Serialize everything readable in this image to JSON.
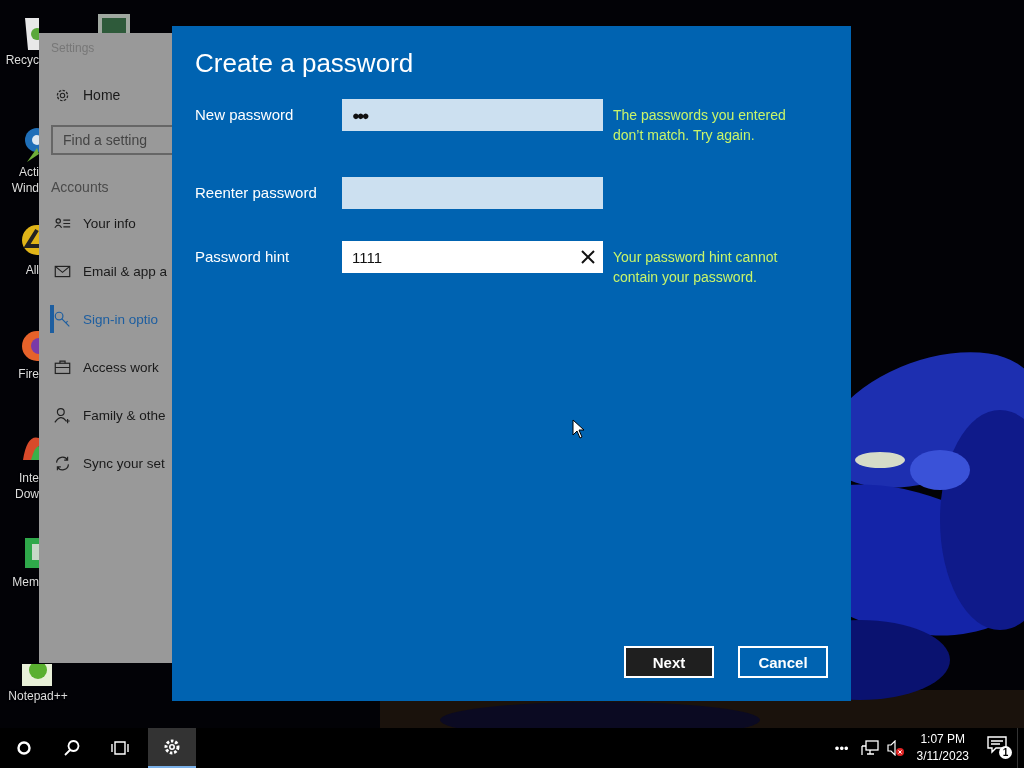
{
  "desktop": {
    "icons": [
      {
        "kind": "recycle",
        "label": "Recyc"
      },
      {
        "kind": "monitor"
      },
      {
        "kind": "pin",
        "label": "Acti Wind"
      },
      {
        "kind": "four",
        "label": "All"
      },
      {
        "kind": "fox",
        "label": "Fire"
      },
      {
        "kind": "swirl",
        "label": "Inte Dow"
      },
      {
        "kind": "chip",
        "label": "Mem"
      },
      {
        "kind": "notepad",
        "label": "Notepad++"
      }
    ]
  },
  "settings_window": {
    "title": "Settings",
    "home": "Home",
    "search": {
      "placeholder": "Find a setting"
    },
    "section": "Accounts",
    "items": [
      {
        "kind": "info",
        "label": "Your info",
        "selected": false
      },
      {
        "kind": "email",
        "label": "Email & app a",
        "selected": false
      },
      {
        "kind": "signin",
        "label": "Sign-in optio",
        "selected": true
      },
      {
        "kind": "work",
        "label": "Access work",
        "selected": false
      },
      {
        "kind": "family",
        "label": "Family & othe",
        "selected": false
      },
      {
        "kind": "sync",
        "label": "Sync your set",
        "selected": false
      }
    ]
  },
  "dialog": {
    "title": "Create a password",
    "fields": [
      {
        "label": "New password",
        "value": "●●●",
        "focused": false,
        "error": "The passwords you entered don’t match. Try again."
      },
      {
        "label": "Reenter password",
        "focused": false
      },
      {
        "label": "Password hint",
        "value": "1111",
        "focused": true,
        "error": "Your password hint cannot contain your password."
      }
    ],
    "buttons": [
      {
        "label": "Next",
        "kind": "primary"
      },
      {
        "label": "Cancel",
        "kind": "secondary"
      }
    ]
  },
  "taskbar": {
    "apps": [
      {
        "kind": "start",
        "active": false
      },
      {
        "kind": "search",
        "active": false
      },
      {
        "kind": "taskview",
        "active": false
      },
      {
        "kind": "settings",
        "active": true
      }
    ],
    "overflow": "•••",
    "time": "1:07 PM",
    "date": "3/11/2023",
    "notifications": "1"
  }
}
